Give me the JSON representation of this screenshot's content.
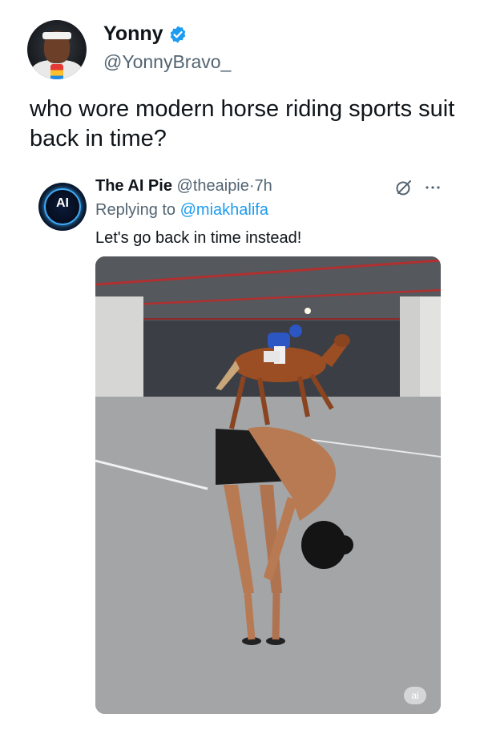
{
  "tweet": {
    "author_name": "Yonny",
    "author_handle": "@YonnyBravo_",
    "verified": true,
    "text": "who wore modern horse riding sports suit back in time?"
  },
  "quoted_tweet": {
    "author_name": "The AI Pie",
    "author_handle": "@theaipie",
    "separator": "·",
    "time": "7h",
    "replying_prefix": "Replying to ",
    "replying_to": "@miakhalifa",
    "text": "Let's go back in time instead!",
    "avatar_text": "AI",
    "media_badge": "ai",
    "media": {
      "type": "image",
      "subject": "horse-and-jockey-in-parking-garage"
    }
  },
  "colors": {
    "primary_text": "#0f1419",
    "secondary_text": "#536471",
    "accent_blue": "#1d9bf0"
  },
  "icons": {
    "verified": "verified-badge-icon",
    "grok": "grok-icon",
    "more": "more-options-icon"
  }
}
